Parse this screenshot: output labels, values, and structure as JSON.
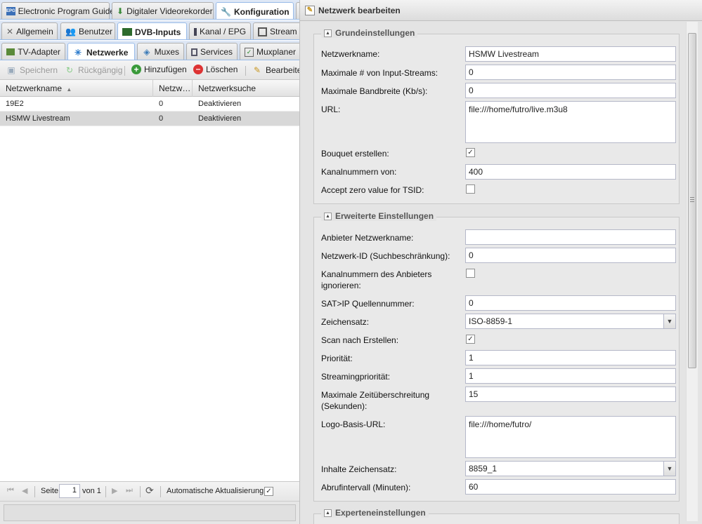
{
  "top_tabs": [
    {
      "label": "Electronic Program Guide",
      "icon": "epg-icon"
    },
    {
      "label": "Digitaler Videorekorder",
      "icon": "download-icon"
    },
    {
      "label": "Konfiguration",
      "icon": "wrench-icon"
    }
  ],
  "sub_tabs": [
    {
      "label": "Allgemein",
      "icon": "tools-icon"
    },
    {
      "label": "Benutzer",
      "icon": "users-icon"
    },
    {
      "label": "DVB-Inputs",
      "icon": "card-icon"
    },
    {
      "label": "Kanal / EPG",
      "icon": "tv-icon"
    },
    {
      "label": "Stream",
      "icon": "film-icon"
    }
  ],
  "third_tabs": [
    {
      "label": "TV-Adapter",
      "icon": "adapter-icon"
    },
    {
      "label": "Netzwerke",
      "icon": "antenna-icon"
    },
    {
      "label": "Muxes",
      "icon": "satellite-icon"
    },
    {
      "label": "Services",
      "icon": "services-icon"
    },
    {
      "label": "Muxplaner",
      "icon": "scheduler-icon"
    }
  ],
  "toolbar": {
    "save": "Speichern",
    "undo": "Rückgängig",
    "add": "Hinzufügen",
    "delete": "Löschen",
    "edit": "Bearbeiten"
  },
  "grid": {
    "columns": [
      "Netzwerkname",
      "Netzw…",
      "Netzwerksuche"
    ],
    "rows": [
      {
        "name": "19E2",
        "count": "0",
        "scan": "Deaktivieren"
      },
      {
        "name": "HSMW Livestream",
        "count": "0",
        "scan": "Deaktivieren"
      }
    ]
  },
  "pager": {
    "page_label": "Seite",
    "page": "1",
    "of_label": "von 1",
    "auto_refresh": "Automatische Aktualisierung"
  },
  "panel": {
    "title": "Netzwerk bearbeiten",
    "basic": {
      "legend": "Grundeinstellungen",
      "name_label": "Netzwerkname:",
      "name": "HSMW Livestream",
      "max_streams_label": "Maximale # von Input-Streams:",
      "max_streams": "0",
      "max_bw_label": "Maximale Bandbreite (Kb/s):",
      "max_bw": "0",
      "url_label": "URL:",
      "url": "file:///home/futro/live.m3u8",
      "bouquet_label": "Bouquet erstellen:",
      "chnum_label": "Kanalnummern von:",
      "chnum": "400",
      "tsid_label": "Accept zero value for TSID:"
    },
    "advanced": {
      "legend": "Erweiterte Einstellungen",
      "provider_label": "Anbieter Netzwerkname:",
      "provider": "",
      "netid_label": "Netzwerk-ID (Suchbeschränkung):",
      "netid": "0",
      "ignore_label_1": "Kanalnummern des Anbieters",
      "ignore_label_2": "ignorieren:",
      "satip_label": "SAT>IP Quellennummer:",
      "satip": "0",
      "charset_label": "Zeichensatz:",
      "charset": "ISO-8859-1",
      "scan_label": "Scan nach Erstellen:",
      "prio_label": "Priorität:",
      "prio": "1",
      "sprio_label": "Streamingpriorität:",
      "sprio": "1",
      "timeout_label_1": "Maximale Zeitüberschreitung",
      "timeout_label_2": "(Sekunden):",
      "timeout": "15",
      "logo_label": "Logo-Basis-URL:",
      "logo": "file:///home/futro/",
      "content_charset_label": "Inhalte Zeichensatz:",
      "content_charset": "8859_1",
      "interval_label": "Abrufintervall (Minuten):",
      "interval": "60"
    },
    "expert": {
      "legend": "Experteneinstellungen"
    }
  }
}
